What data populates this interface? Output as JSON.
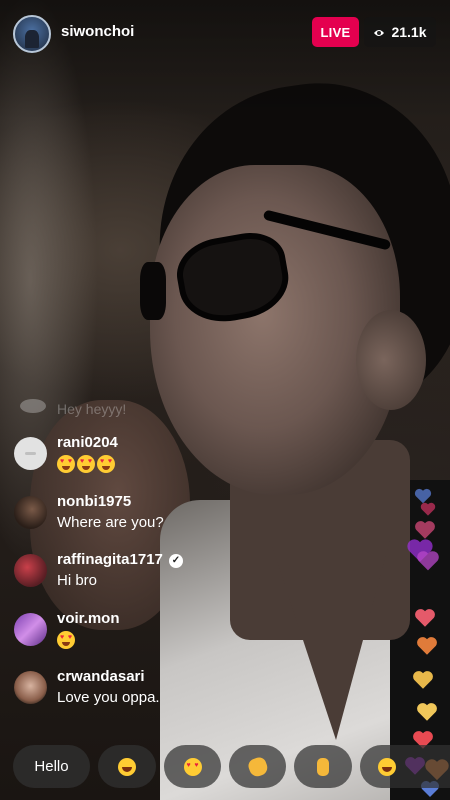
{
  "header": {
    "username": "siwonchoi",
    "live_label": "LIVE",
    "viewer_count": "21.1k",
    "viewer_icon": "eye-icon"
  },
  "comments": [
    {
      "username": "",
      "text": "Hey heyyy!",
      "faded": true
    },
    {
      "username": "rani0204",
      "text": "",
      "emoji_count": 3,
      "emoji": "heart-eyes"
    },
    {
      "username": "nonbi1975",
      "text": "Where are you?"
    },
    {
      "username": "raffinagita1717",
      "verified": true,
      "text": "Hi bro"
    },
    {
      "username": "voir.mon",
      "text": "",
      "emoji_count": 1,
      "emoji": "heart-eyes"
    },
    {
      "username": "crwandasari",
      "text": "Love you oppa."
    }
  ],
  "reactions": [
    {
      "label": "Hello"
    },
    {
      "emoji": "laughing-emoji"
    },
    {
      "emoji": "heart-eyes-emoji"
    },
    {
      "emoji": "waving-hand-emoji"
    },
    {
      "emoji": "thumbs-up-emoji"
    },
    {
      "emoji": "laughing-emoji"
    }
  ],
  "colors": {
    "live": "#e4004f",
    "hearts": [
      "#5a7dd6",
      "#c7325f",
      "#d64a7a",
      "#9b30d9",
      "#b847c9",
      "#e55a6a",
      "#e07b3a",
      "#e8b84a",
      "#f0c75a",
      "#e84a52",
      "#f08a3a",
      "#a02fd0"
    ]
  }
}
